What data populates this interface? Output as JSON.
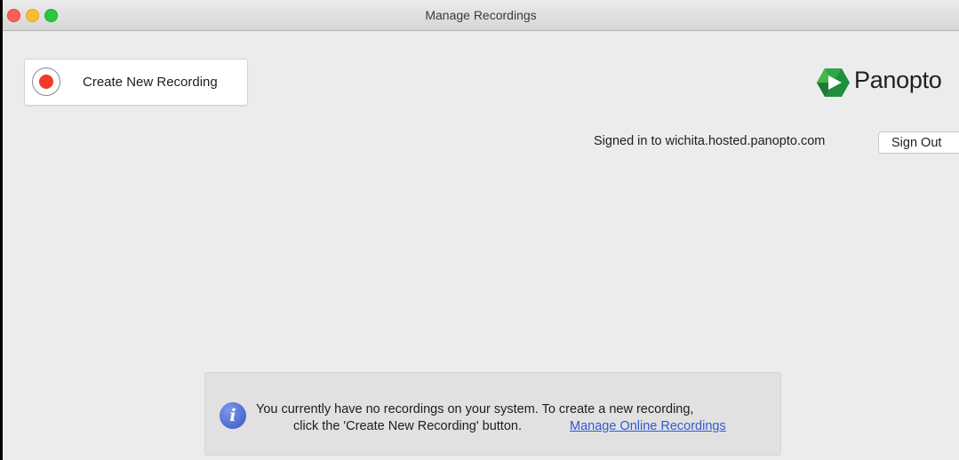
{
  "window": {
    "title": "Manage Recordings"
  },
  "toolbar": {
    "create_label": "Create New Recording"
  },
  "brand": {
    "name": "Panopto",
    "colors": {
      "green_dark": "#1f8f3e",
      "green_light": "#48b649"
    }
  },
  "account": {
    "signed_in_text": "Signed in to wichita.hosted.panopto.com",
    "sign_out_label": "Sign Out"
  },
  "info": {
    "message_line1": "You currently have no recordings on your system. To create a new recording,",
    "message_line2": "click the 'Create New Recording' button.",
    "link_label": "Manage Online Recordings"
  },
  "colors": {
    "record_red": "#f23a25",
    "link_blue": "#2f5bd3",
    "info_blue": "#3556c8"
  }
}
